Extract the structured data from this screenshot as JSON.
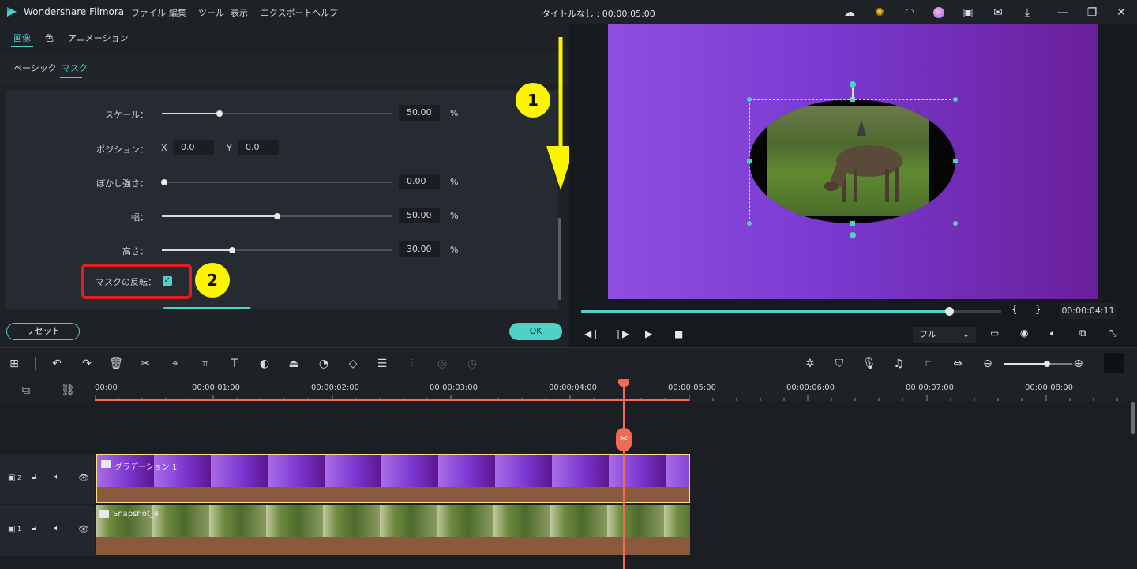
{
  "app": {
    "name": "Wondershare Filmora",
    "menu": [
      "ファイル",
      "編集",
      "ツール",
      "表示",
      "エクスポート",
      "ヘルプ"
    ],
    "doc_title": "タイトルなし : 00:00:05:00"
  },
  "titlebar_icons": [
    "cloud-icon",
    "lightbulb-icon",
    "headset-icon",
    "avatar-icon",
    "save-icon",
    "mail-icon",
    "download-icon",
    "minimize-icon",
    "restore-icon",
    "close-icon"
  ],
  "top_tabs": [
    "画像",
    "色",
    "アニメーション"
  ],
  "sub_tabs": [
    "ベーシック",
    "マスク"
  ],
  "props": {
    "scale": {
      "label": "スケール：",
      "value": "50.00",
      "unit": "%",
      "fraction": 0.25
    },
    "position": {
      "label": "ポジション：",
      "x_label": "X",
      "x_value": "0.0",
      "y_label": "Y",
      "y_value": "0.0"
    },
    "blur": {
      "label": "ぼかし強さ：",
      "value": "0.00",
      "unit": "%",
      "fraction": 0.0
    },
    "width": {
      "label": "幅：",
      "value": "50.00",
      "unit": "%",
      "fraction": 0.5
    },
    "height": {
      "label": "高さ：",
      "value": "30.00",
      "unit": "%",
      "fraction": 0.3
    },
    "invert": {
      "label": "マスクの反転：",
      "checked": true
    }
  },
  "buttons": {
    "reset": "リセット",
    "ok": "OK"
  },
  "annotations": {
    "step1": "1",
    "step2": "2"
  },
  "preview": {
    "timecode": "00:00:04:11",
    "progress": 0.88,
    "quality": "フル",
    "brackets": [
      "{",
      "}"
    ]
  },
  "toolbar_icons": [
    "layout-icon",
    "undo-icon",
    "redo-icon",
    "delete-icon",
    "cut-icon",
    "tag-icon",
    "crop-icon",
    "text-icon",
    "color-icon",
    "stabilize-icon",
    "speed-icon",
    "keyframe-icon",
    "adjust-icon",
    "audio-icon",
    "green-screen-icon",
    "duration-icon"
  ],
  "toolbar_right_icons": [
    "render-icon",
    "marker-icon",
    "mic-icon",
    "music-icon",
    "snap-icon",
    "fit-icon",
    "zoom-out-icon",
    "zoom-in-icon"
  ],
  "timeline": {
    "ruler": [
      "00:00",
      "00:00:01:00",
      "00:00:02:00",
      "00:00:03:00",
      "00:00:04:00",
      "00:00:05:00",
      "00:00:06:00",
      "00:00:07:00",
      "00:00:08:00"
    ],
    "tracks": [
      {
        "number": "2",
        "clip": "グラデーション 1"
      },
      {
        "number": "1",
        "clip": "Snapshot_4"
      }
    ]
  },
  "colors": {
    "accent": "#4fd1c5",
    "playhead": "#f06a55",
    "highlight": "#e01e1e",
    "annotation": "#fdf400"
  }
}
